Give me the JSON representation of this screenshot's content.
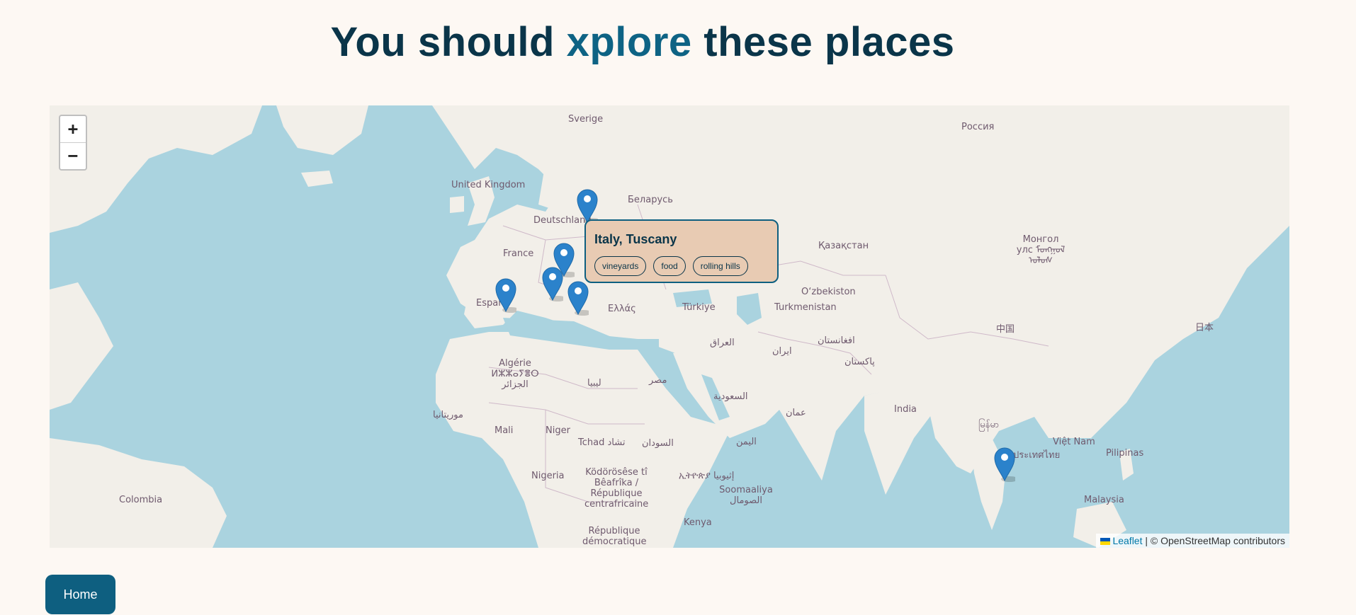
{
  "header": {
    "title_before": "You should ",
    "title_accent": "xplore",
    "title_after": " these places"
  },
  "map": {
    "zoom_in": "+",
    "zoom_out": "−",
    "labels": [
      "Sverige",
      "Россия",
      "United Kingdom",
      "Беларусь",
      "Deutschland",
      "France",
      "España",
      "Ελλάς",
      "Türkiye",
      "Қазақстан",
      "Монгол улс ᠮᠣᠩᠭᠣᠯ ᠤᠯᠤᠰ",
      "O‘zbekiston",
      "Turkmenistan",
      "中国",
      "日本",
      "افغانستان",
      "ایران",
      "العراق",
      "پاکستان",
      "Algérie ⵍⵣⵣⴰⵢⴻⵔ الجزائر",
      "ليبيا",
      "مصر",
      "السعودية",
      "عمان",
      "اليمن",
      "India",
      "موريتانيا",
      "Mali",
      "Niger",
      "Tchad تشاد",
      "السودان",
      "ኢትዮጵያ إثيوبيا",
      "Nigeria",
      "Ködörösêse tî Bêafrîka / République centrafricaine",
      "Soomaaliya الصومال",
      "Kenya",
      "République démocratique",
      "Colombia",
      "Việt Nam",
      "Pilipinas",
      "Malaysia",
      "မြန်မာ",
      "ประเทศไทย"
    ],
    "popup": {
      "title": "Italy, Tuscany",
      "tags": [
        "vineyards",
        "food",
        "rolling hills"
      ]
    },
    "attribution": {
      "link": "Leaflet",
      "text": " | © OpenStreetMap contributors"
    },
    "colors": {
      "water": "#aad3df",
      "land": "#f2efe9",
      "marker": "#2b82cb",
      "popup_bg": "#e8cbb3",
      "accent": "#0e5f80"
    }
  },
  "nav": {
    "home_label": "Home"
  }
}
